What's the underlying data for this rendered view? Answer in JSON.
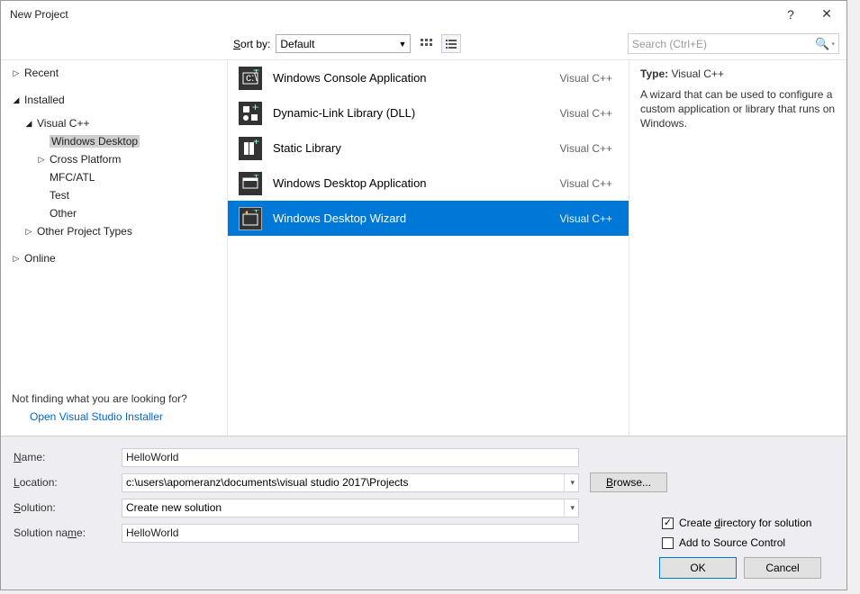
{
  "dialog": {
    "title": "New Project",
    "help": "?",
    "close": "✕"
  },
  "toolbar": {
    "sort_label_pre": "S",
    "sort_label_post": "ort by:",
    "sort_value": "Default",
    "search_placeholder": "Search (Ctrl+E)"
  },
  "sidebar": {
    "recent": "Recent",
    "installed": "Installed",
    "vcpp": "Visual C++",
    "windows_desktop": "Windows Desktop",
    "cross_platform": "Cross Platform",
    "mfc_atl": "MFC/ATL",
    "test": "Test",
    "other": "Other",
    "other_project_types": "Other Project Types",
    "online": "Online",
    "not_finding": "Not finding what you are looking for?",
    "open_installer": "Open Visual Studio Installer"
  },
  "templates": [
    {
      "name": "Windows Console Application",
      "lang": "Visual C++",
      "selected": false
    },
    {
      "name": "Dynamic-Link Library (DLL)",
      "lang": "Visual C++",
      "selected": false
    },
    {
      "name": "Static Library",
      "lang": "Visual C++",
      "selected": false
    },
    {
      "name": "Windows Desktop Application",
      "lang": "Visual C++",
      "selected": false
    },
    {
      "name": "Windows Desktop Wizard",
      "lang": "Visual C++",
      "selected": true
    }
  ],
  "desc": {
    "type_label": "Type:",
    "type_value": "Visual C++",
    "text": "A wizard that can be used to configure a custom application or library that runs on Windows."
  },
  "form": {
    "name_label": "Name:",
    "name_value": "HelloWorld",
    "location_label": "Location:",
    "location_value": "c:\\users\\apomeranz\\documents\\visual studio 2017\\Projects",
    "browse_label": "Browse...",
    "solution_label": "Solution:",
    "solution_value": "Create new solution",
    "solution_name_label": "Solution name:",
    "solution_name_value": "HelloWorld",
    "create_dir_label": "Create directory for solution",
    "create_dir_checked": true,
    "source_control_label": "Add to Source Control",
    "source_control_checked": false
  },
  "footer": {
    "ok": "OK",
    "cancel": "Cancel"
  }
}
